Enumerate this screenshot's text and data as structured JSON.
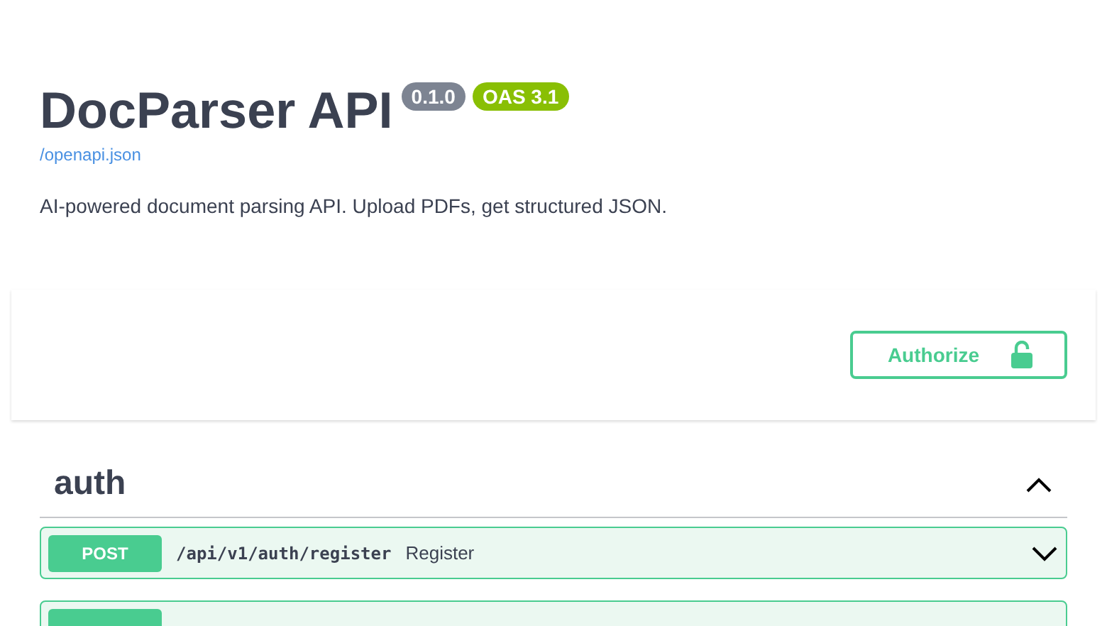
{
  "info": {
    "title": "DocParser API",
    "version": "0.1.0",
    "spec_version": "OAS 3.1",
    "spec_link": "/openapi.json",
    "description": "AI-powered document parsing API. Upload PDFs, get structured JSON."
  },
  "authorize_button": {
    "label": "Authorize",
    "locked": false
  },
  "tags": [
    {
      "name": "auth",
      "expanded": true,
      "operations": [
        {
          "kind": "post",
          "method": "POST",
          "path": "/api/v1/auth/register",
          "summary": "Register"
        }
      ]
    }
  ]
}
